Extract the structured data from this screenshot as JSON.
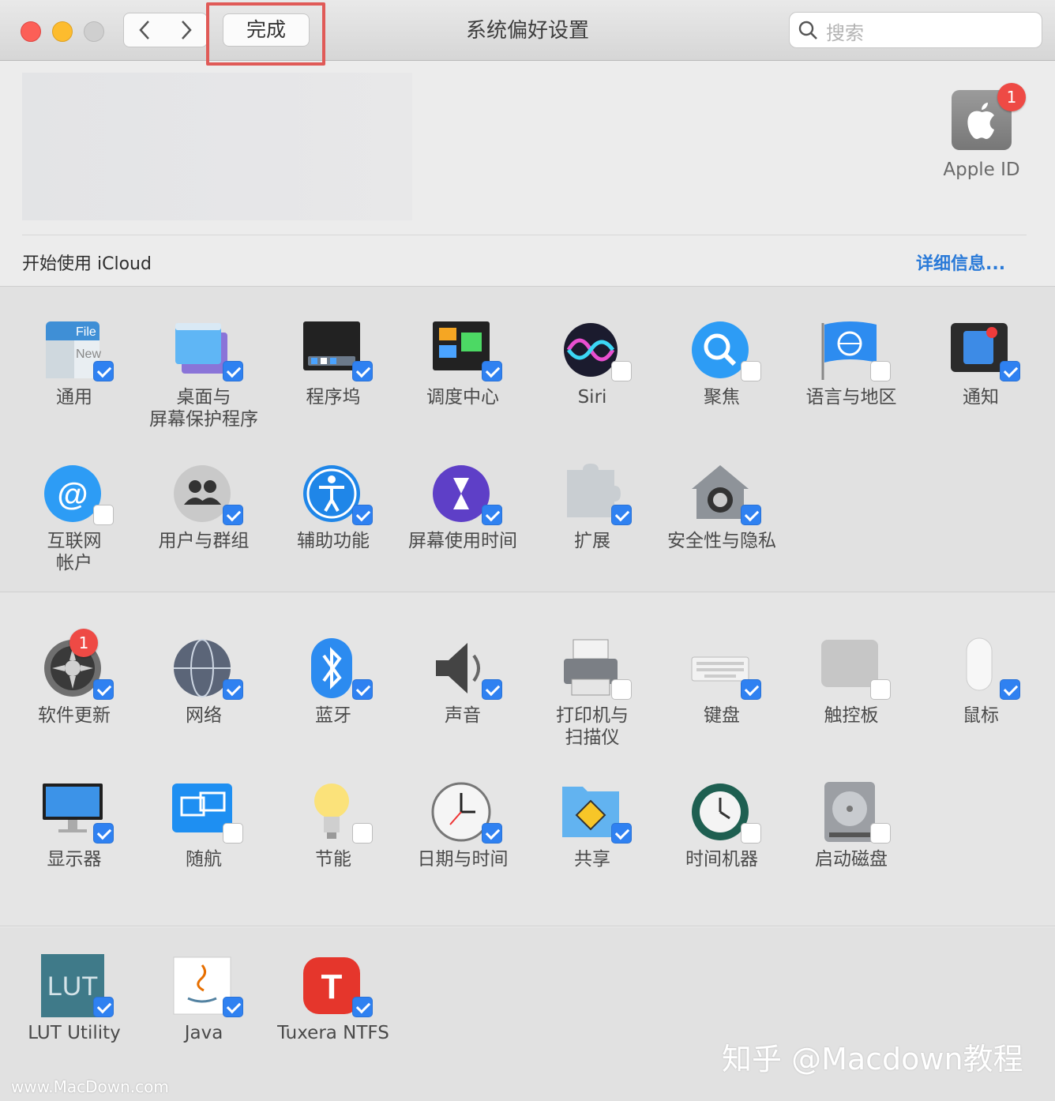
{
  "window": {
    "title": "系统偏好设置",
    "done_label": "完成",
    "search_placeholder": "搜索"
  },
  "account": {
    "apple_id_label": "Apple ID",
    "apple_id_badge": "1",
    "icloud_text": "开始使用 iCloud",
    "details_link": "详细信息..."
  },
  "sections": {
    "personal": [
      {
        "id": "general",
        "label": "通用",
        "icon": "general-icon",
        "checked": true
      },
      {
        "id": "desktop",
        "label": "桌面与\n屏幕保护程序",
        "icon": "desktop-screensaver-icon",
        "checked": true
      },
      {
        "id": "dock",
        "label": "程序坞",
        "icon": "dock-icon",
        "checked": true
      },
      {
        "id": "mission",
        "label": "调度中心",
        "icon": "mission-control-icon",
        "checked": true
      },
      {
        "id": "siri",
        "label": "Siri",
        "icon": "siri-icon",
        "checked": false
      },
      {
        "id": "spotlight",
        "label": "聚焦",
        "icon": "spotlight-icon",
        "checked": false
      },
      {
        "id": "language",
        "label": "语言与地区",
        "icon": "language-region-icon",
        "checked": false
      },
      {
        "id": "notifications",
        "label": "通知",
        "icon": "notifications-icon",
        "checked": true
      },
      {
        "id": "internet",
        "label": "互联网\n帐户",
        "icon": "internet-accounts-icon",
        "checked": false
      },
      {
        "id": "users",
        "label": "用户与群组",
        "icon": "users-groups-icon",
        "checked": true
      },
      {
        "id": "accessibility",
        "label": "辅助功能",
        "icon": "accessibility-icon",
        "checked": true
      },
      {
        "id": "screentime",
        "label": "屏幕使用时间",
        "icon": "screen-time-icon",
        "checked": true
      },
      {
        "id": "extensions",
        "label": "扩展",
        "icon": "extensions-icon",
        "checked": true
      },
      {
        "id": "security",
        "label": "安全性与隐私",
        "icon": "security-privacy-icon",
        "checked": true
      }
    ],
    "hardware": [
      {
        "id": "update",
        "label": "软件更新",
        "icon": "software-update-icon",
        "checked": true,
        "badge": "1"
      },
      {
        "id": "network",
        "label": "网络",
        "icon": "network-icon",
        "checked": true
      },
      {
        "id": "bluetooth",
        "label": "蓝牙",
        "icon": "bluetooth-icon",
        "checked": true
      },
      {
        "id": "sound",
        "label": "声音",
        "icon": "sound-icon",
        "checked": true
      },
      {
        "id": "printers",
        "label": "打印机与\n扫描仪",
        "icon": "printers-scanners-icon",
        "checked": false
      },
      {
        "id": "keyboard",
        "label": "键盘",
        "icon": "keyboard-icon",
        "checked": true
      },
      {
        "id": "trackpad",
        "label": "触控板",
        "icon": "trackpad-icon",
        "checked": false
      },
      {
        "id": "mouse",
        "label": "鼠标",
        "icon": "mouse-icon",
        "checked": true
      },
      {
        "id": "displays",
        "label": "显示器",
        "icon": "displays-icon",
        "checked": true
      },
      {
        "id": "sidecar",
        "label": "随航",
        "icon": "sidecar-icon",
        "checked": false
      },
      {
        "id": "energy",
        "label": "节能",
        "icon": "energy-saver-icon",
        "checked": false
      },
      {
        "id": "datetime",
        "label": "日期与时间",
        "icon": "date-time-icon",
        "checked": true
      },
      {
        "id": "sharing",
        "label": "共享",
        "icon": "sharing-icon",
        "checked": true
      },
      {
        "id": "timemachine",
        "label": "时间机器",
        "icon": "time-machine-icon",
        "checked": false
      },
      {
        "id": "startup",
        "label": "启动磁盘",
        "icon": "startup-disk-icon",
        "checked": false
      }
    ],
    "other": [
      {
        "id": "lut",
        "label": "LUT Utility",
        "icon": "lut-utility-icon",
        "checked": true
      },
      {
        "id": "java",
        "label": "Java",
        "icon": "java-icon",
        "checked": true
      },
      {
        "id": "tuxera",
        "label": "Tuxera NTFS",
        "icon": "tuxera-ntfs-icon",
        "checked": true
      }
    ]
  },
  "watermark": "知乎 @Macdown教程",
  "site_mark": "www.MacDown.com"
}
